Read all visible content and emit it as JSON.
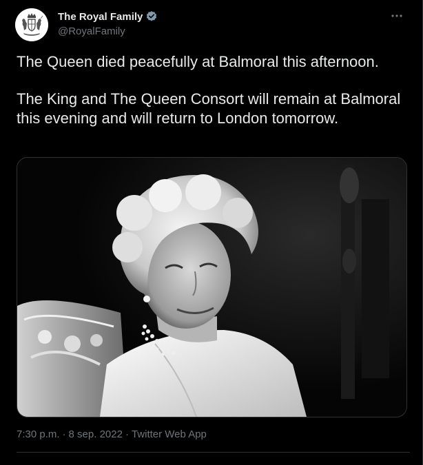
{
  "tweet": {
    "author": {
      "display_name": "The Royal Family",
      "handle": "@RoyalFamily",
      "verified": true,
      "avatar_icon": "royal-coat-of-arms-icon"
    },
    "more_icon": "more-horizontal-icon",
    "text": {
      "paragraph_1": "The Queen died peacefully at Balmoral this afternoon.",
      "paragraph_2": "The King and The Queen Consort will remain at Balmoral this evening and will return to London tomorrow."
    },
    "media": {
      "type": "black-and-white photo portrait"
    },
    "meta": {
      "time": "7:30 p.m.",
      "separator": "·",
      "date": "8 sep. 2022",
      "source": "Twitter Web App"
    }
  },
  "colors": {
    "background": "#000000",
    "text_primary": "#e7e9ea",
    "text_secondary": "#71767b",
    "border": "#2f3336",
    "verified": "#829aab"
  }
}
